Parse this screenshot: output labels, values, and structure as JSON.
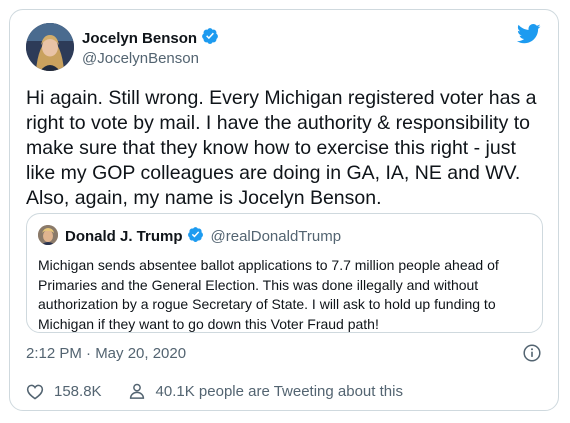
{
  "colors": {
    "twitter_blue": "#1d9bf0",
    "text_primary": "#0f1419",
    "text_secondary": "#536471",
    "border": "#cfd9de"
  },
  "tweet": {
    "author": {
      "name": "Jocelyn Benson",
      "handle": "@JocelynBenson",
      "verified": true
    },
    "text": "Hi again. Still wrong. Every Michigan registered voter has a right to vote by mail. I have the authority & responsibility to make sure that they know how to exercise this right - just like my GOP colleagues are doing in GA, IA, NE and WV. Also, again, my name is Jocelyn Benson.",
    "quoted": {
      "author_name": "Donald J. Trump",
      "author_handle": "@realDonaldTrump",
      "verified": true,
      "text": "Michigan sends absentee ballot applications to 7.7 million people ahead of Primaries and the General Election. This was done illegally and without authorization by a rogue Secretary of State. I will ask to hold up funding to Michigan if they want to go down this Voter Fraud path!"
    },
    "timestamp": "2:12 PM · May 20, 2020",
    "likes": "158.8K",
    "retweet_text": "40.1K people are Tweeting about this"
  },
  "icons": {
    "brand": "twitter-bird-icon",
    "verified": "verified-badge-icon",
    "info": "info-icon",
    "like": "heart-icon",
    "discuss": "person-icon"
  }
}
